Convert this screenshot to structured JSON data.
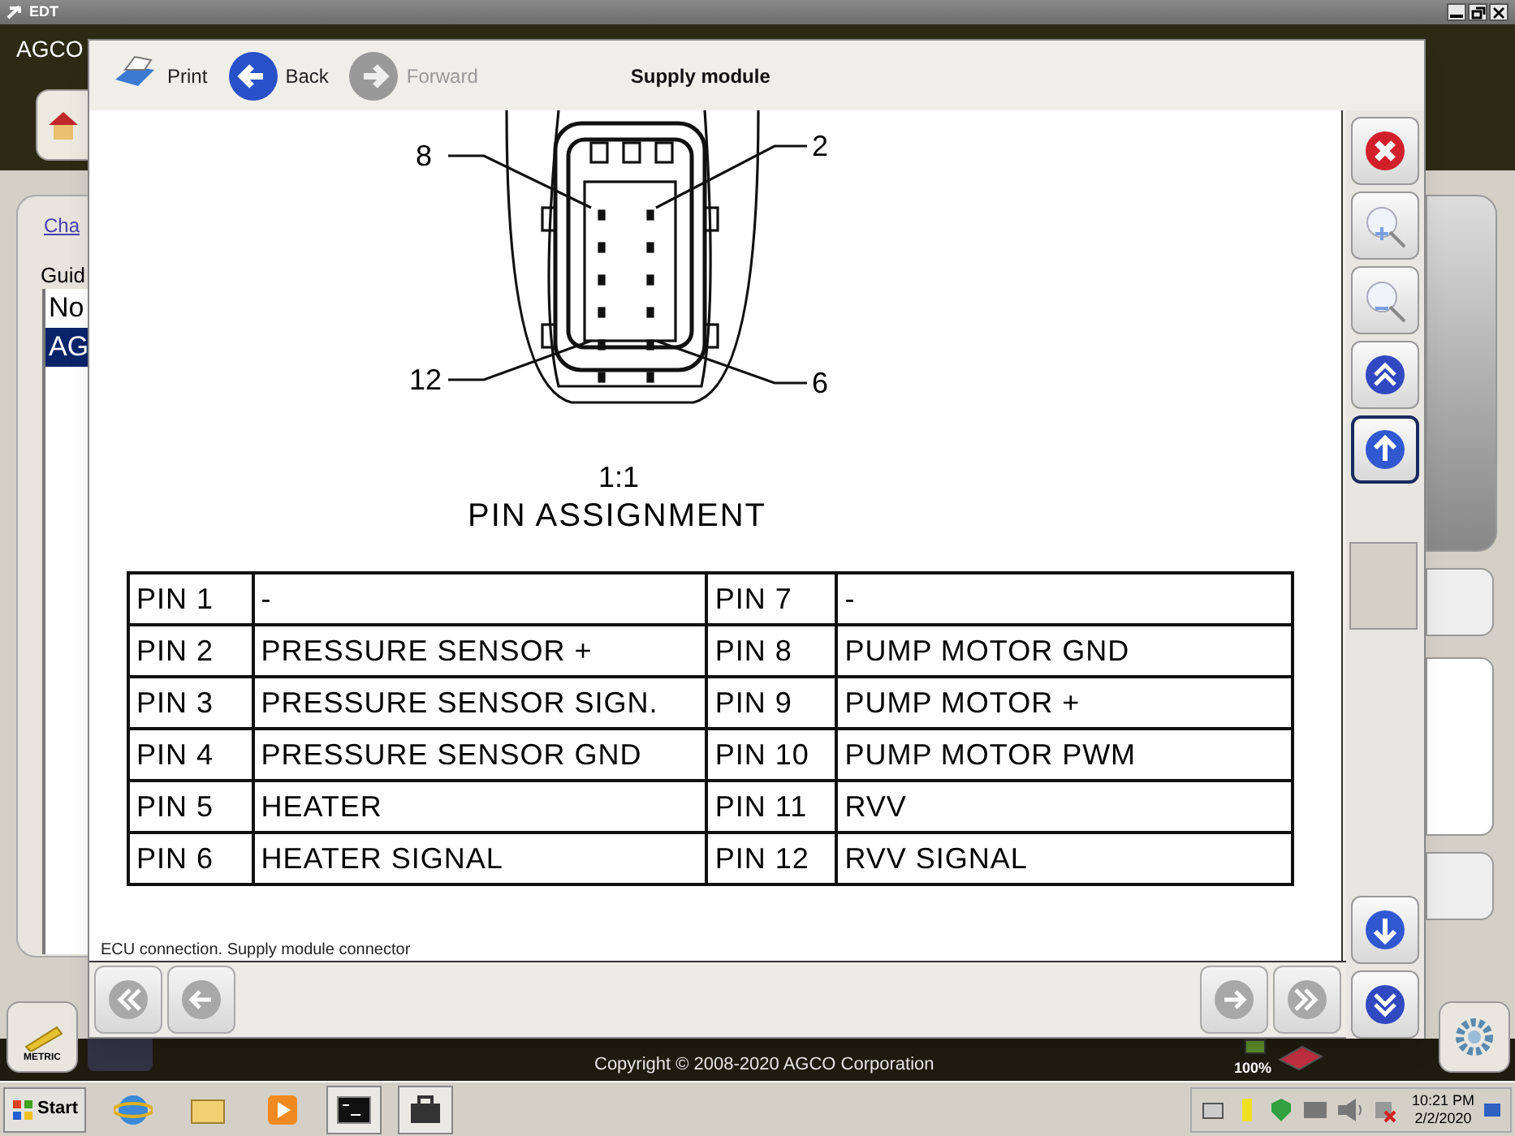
{
  "window": {
    "title": "EDT"
  },
  "app": {
    "brand": "AGCO",
    "link": "Cha",
    "guide_label": "Guid",
    "guide_list": [
      {
        "label": "No",
        "selected": false
      },
      {
        "label": "AG",
        "selected": true
      }
    ],
    "units_button": "METRIC",
    "copyright": "Copyright © 2008-2020 AGCO Corporation",
    "battery": "100%"
  },
  "viewer": {
    "toolbar": [
      {
        "kind": "print",
        "label": "Print",
        "disabled": false
      },
      {
        "kind": "back",
        "label": "Back",
        "disabled": false
      },
      {
        "kind": "forward",
        "label": "Forward",
        "disabled": true
      }
    ],
    "title": "Supply module",
    "diagram": {
      "pin_labels": [
        "8",
        "2",
        "12",
        "6"
      ],
      "scale": "1:1",
      "heading": "PIN ASSIGNMENT"
    },
    "table": {
      "rows": [
        [
          "PIN 1",
          "-",
          "PIN 7",
          "-"
        ],
        [
          "PIN 2",
          "PRESSURE SENSOR +",
          "PIN 8",
          "PUMP MOTOR GND"
        ],
        [
          "PIN 3",
          "PRESSURE SENSOR SIGN.",
          "PIN 9",
          "PUMP MOTOR +"
        ],
        [
          "PIN 4",
          "PRESSURE SENSOR GND",
          "PIN 10",
          "PUMP MOTOR PWM"
        ],
        [
          "PIN 5",
          "HEATER",
          "PIN 11",
          "RVV"
        ],
        [
          "PIN 6",
          "HEATER SIGNAL",
          "PIN 12",
          "RVV SIGNAL"
        ]
      ]
    },
    "caption": "ECU connection. Supply module connector",
    "side_buttons": [
      {
        "kind": "close",
        "selected": false
      },
      {
        "kind": "zoom-in",
        "selected": false
      },
      {
        "kind": "zoom-out",
        "selected": false
      },
      {
        "kind": "page-up",
        "selected": false
      },
      {
        "kind": "up",
        "selected": true
      },
      {
        "kind": "down",
        "selected": false
      },
      {
        "kind": "page-down",
        "selected": false
      }
    ],
    "nav_buttons": [
      {
        "kind": "first",
        "disabled": true
      },
      {
        "kind": "previous",
        "disabled": true
      },
      {
        "kind": "next",
        "disabled": true
      },
      {
        "kind": "last",
        "disabled": true
      }
    ]
  },
  "taskbar": {
    "start": "Start",
    "time": "10:21 PM",
    "date": "2/2/2020"
  }
}
